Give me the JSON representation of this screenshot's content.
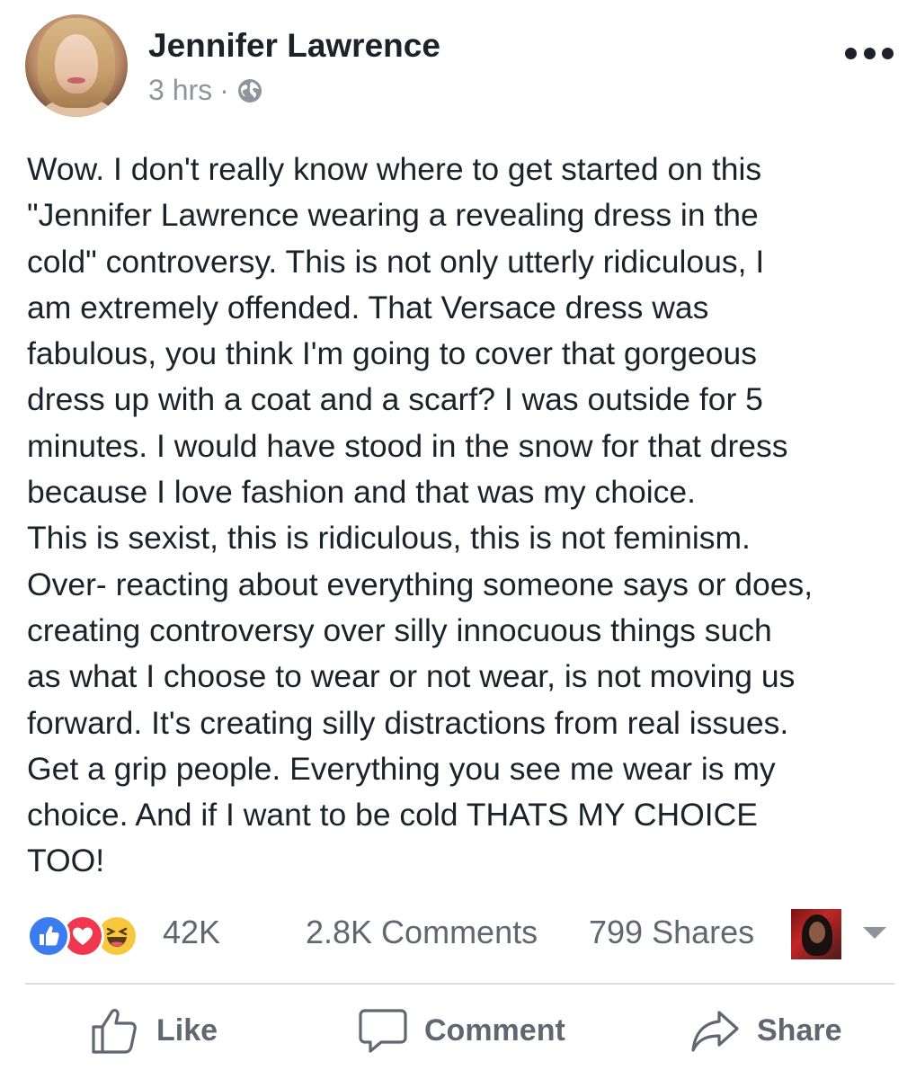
{
  "post": {
    "author": "Jennifer Lawrence",
    "timestamp": "3 hrs",
    "separator": "·",
    "privacy_icon": "globe-icon",
    "more_icon": "more-icon",
    "body_lines": [
      "Wow. I don't really know where to get started on this",
      "\"Jennifer Lawrence wearing a revealing dress in the",
      "cold\" controversy. This is not only utterly ridiculous, I",
      "am extremely offended. That Versace dress was",
      "fabulous, you think I'm going to cover that gorgeous",
      "dress up with a coat and a scarf? I was outside for 5",
      "minutes. I would have stood in the snow for that dress",
      "because I love fashion and that was my choice.",
      "This is sexist, this is ridiculous, this is not feminism.",
      "Over- reacting about everything someone says or does,",
      "creating controversy over silly innocuous things such",
      "as what I choose to wear or not wear, is not moving us",
      "forward. It's creating silly distractions from real issues.",
      "Get a grip people. Everything you see me wear is my",
      "choice. And if I want to be cold THATS MY CHOICE",
      "TOO!"
    ]
  },
  "stats": {
    "reaction_icons": [
      "like-icon",
      "love-icon",
      "haha-icon"
    ],
    "reaction_count": "42K",
    "comments": "2.8K Comments",
    "shares": "799 Shares"
  },
  "actions": {
    "like_label": "Like",
    "comment_label": "Comment",
    "share_label": "Share"
  },
  "colors": {
    "text": "#1d2129",
    "secondary_text": "#90949c",
    "action_text": "#606770",
    "like_blue": "#3b7cf0",
    "love_red": "#f0374f",
    "haha_yellow": "#f7c83e"
  }
}
